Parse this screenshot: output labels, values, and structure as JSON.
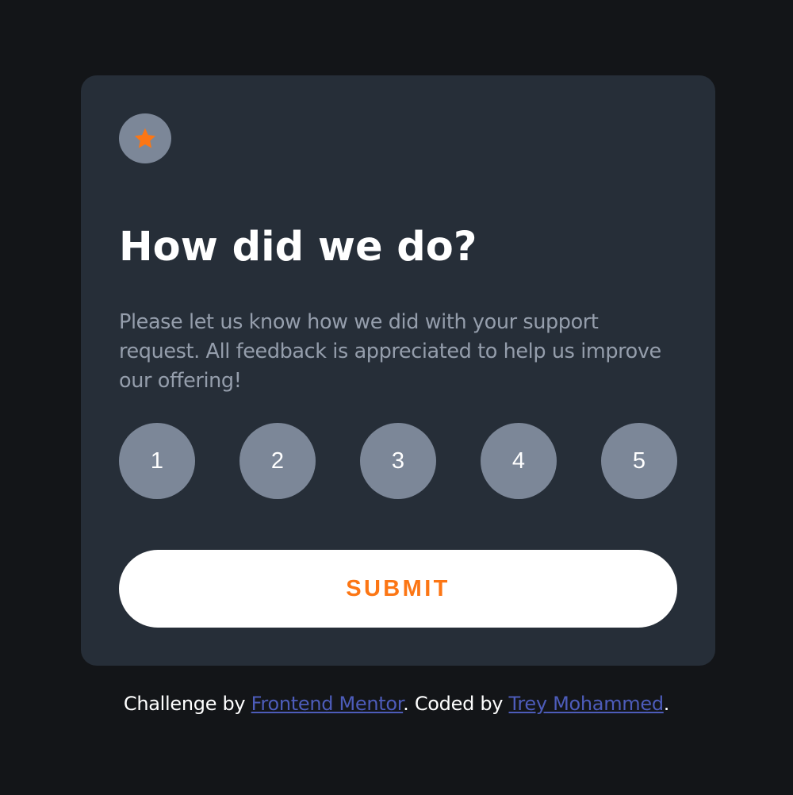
{
  "colors": {
    "page_background": "#131518",
    "card_background": "#262e38",
    "badge_background": "#7c8798",
    "accent_orange": "#fc7614",
    "heading": "#ffffff",
    "body_text": "#959eac",
    "link": "#4d5cba"
  },
  "card": {
    "icon": "star-icon",
    "title": "How did we do?",
    "description": "Please let us know how we did with your support request. All feedback is appreciated to help us improve our offering!",
    "ratings": [
      "1",
      "2",
      "3",
      "4",
      "5"
    ],
    "submit_label": "SUBMIT"
  },
  "attribution": {
    "prefix": "Challenge by ",
    "challenge_link": "Frontend Mentor",
    "middle": ". Coded by ",
    "author_link": "Trey Mohammed",
    "suffix": "."
  }
}
